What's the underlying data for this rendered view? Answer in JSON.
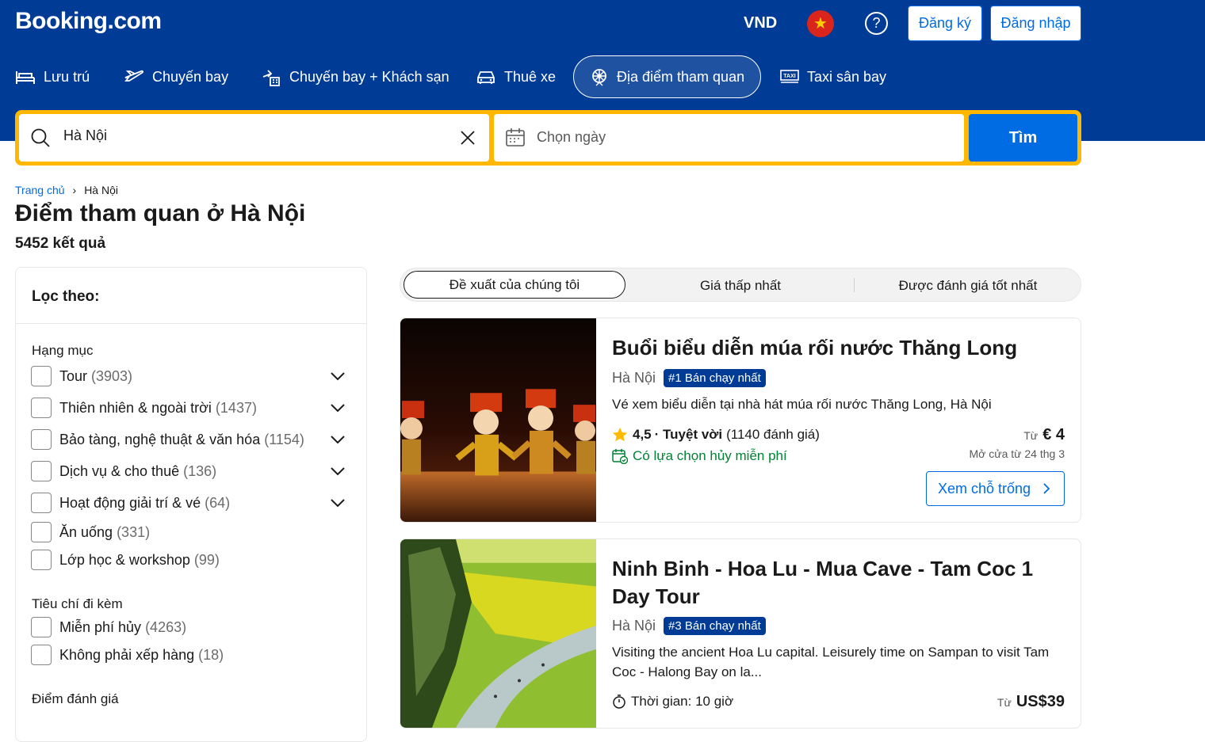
{
  "header": {
    "logo": "Booking.com",
    "currency": "VND",
    "register_label": "Đăng ký",
    "login_label": "Đăng nhập",
    "nav": [
      {
        "label": "Lưu trú",
        "icon": "bed-icon"
      },
      {
        "label": "Chuyến bay",
        "icon": "plane-icon"
      },
      {
        "label": "Chuyến bay + Khách sạn",
        "icon": "flight-hotel-icon"
      },
      {
        "label": "Thuê xe",
        "icon": "car-icon"
      },
      {
        "label": "Địa điểm tham quan",
        "icon": "attraction-icon",
        "active": true
      },
      {
        "label": "Taxi sân bay",
        "icon": "taxi-icon"
      }
    ]
  },
  "search": {
    "destination_value": "Hà Nội",
    "date_placeholder": "Chọn ngày",
    "button_label": "Tìm"
  },
  "breadcrumb": {
    "home": "Trang chủ",
    "current": "Hà Nội"
  },
  "page": {
    "title": "Điểm tham quan ở Hà Nội",
    "result_count": "5452 kết quả"
  },
  "filters": {
    "title": "Lọc theo:",
    "groups": [
      {
        "label": "Hạng mục",
        "items": [
          {
            "label": "Tour",
            "count": "(3903)",
            "expandable": true
          },
          {
            "label": "Thiên nhiên & ngoài trời",
            "count": "(1437)",
            "expandable": true
          },
          {
            "label": "Bảo tàng, nghệ thuật & văn hóa",
            "count": "(1154)",
            "expandable": true
          },
          {
            "label": "Dịch vụ & cho thuê",
            "count": "(136)",
            "expandable": true
          },
          {
            "label": "Hoạt động giải trí & vé",
            "count": "(64)",
            "expandable": true
          },
          {
            "label": "Ăn uống",
            "count": "(331)",
            "expandable": false
          },
          {
            "label": "Lớp học & workshop",
            "count": "(99)",
            "expandable": false
          }
        ]
      },
      {
        "label": "Tiêu chí đi kèm",
        "items": [
          {
            "label": "Miễn phí hủy",
            "count": "(4263)"
          },
          {
            "label": "Không phải xếp hàng",
            "count": "(18)"
          }
        ]
      },
      {
        "label": "Điểm đánh giá",
        "items": []
      }
    ]
  },
  "sort": {
    "options": [
      "Đề xuất của chúng tôi",
      "Giá thấp nhất",
      "Được đánh giá tốt nhất"
    ]
  },
  "results": [
    {
      "title": "Buổi biểu diễn múa rối nước Thăng Long",
      "location": "Hà Nội",
      "badge": "#1 Bán chạy nhất",
      "description": "Vé xem biểu diễn tại nhà hát múa rối nước Thăng Long, Hà Nội",
      "rating": "4,5",
      "rating_word": "· Tuyệt vời",
      "reviews": "(1140 đánh giá)",
      "cancel": "Có lựa chọn hủy miễn phí",
      "price_from": "Từ",
      "price": "€ 4",
      "open_date": "Mở cửa từ 24 thg 3",
      "cta": "Xem chỗ trống"
    },
    {
      "title": "Ninh Binh - Hoa Lu - Mua Cave - Tam Coc 1 Day Tour",
      "location": "Hà Nội",
      "badge": "#3 Bán chạy nhất",
      "description": "Visiting the ancient Hoa Lu capital. Leisurely time on Sampan to visit Tam Coc - Halong Bay on la...",
      "duration": "Thời gian: 10 giờ",
      "price_from": "Từ",
      "price": "US$39"
    }
  ],
  "colors": {
    "brand_blue": "#003b95",
    "action_blue": "#006ce4",
    "search_yellow": "#ffb700",
    "success_green": "#008234"
  }
}
